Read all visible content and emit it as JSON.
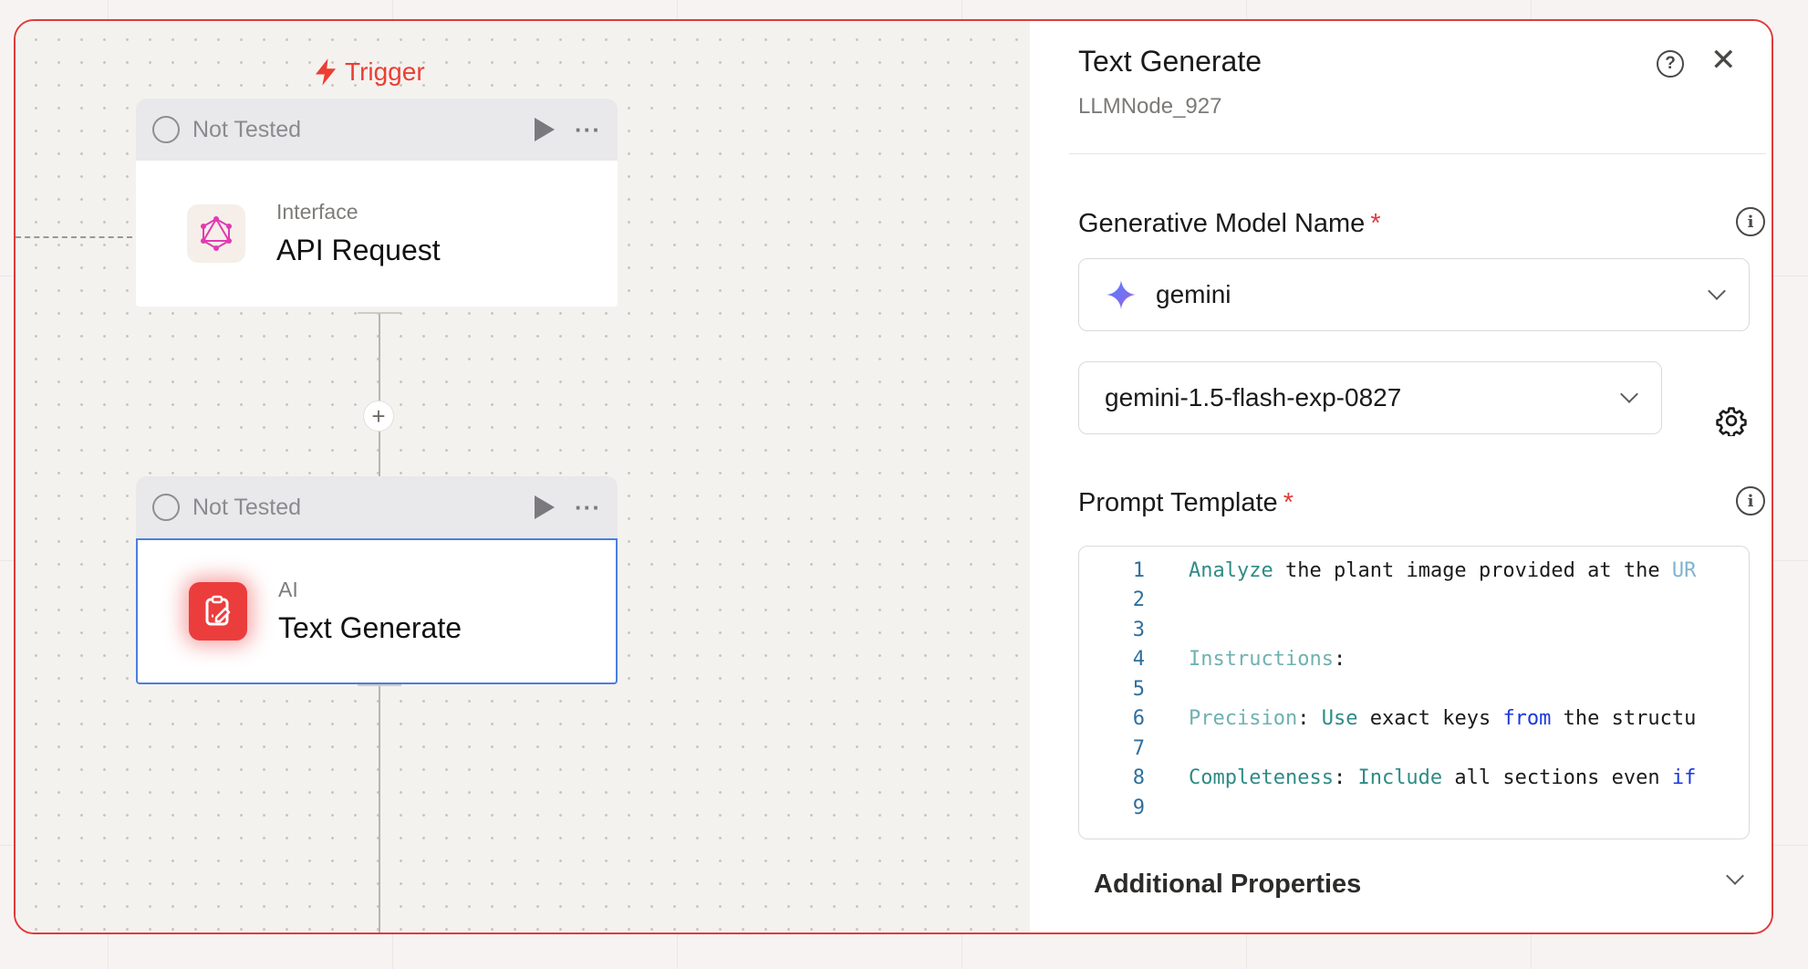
{
  "canvas": {
    "trigger_label": "Trigger",
    "nodes": [
      {
        "status": "Not Tested",
        "kind": "Interface",
        "name": "API Request",
        "icon": "graphql-icon",
        "selected": false
      },
      {
        "status": "Not Tested",
        "kind": "AI",
        "name": "Text Generate",
        "icon": "clipboard-edit-icon",
        "selected": true
      }
    ],
    "add_step_symbol": "+"
  },
  "panel": {
    "title": "Text Generate",
    "subtitle": "LLMNode_927",
    "help_symbol": "?",
    "close_symbol": "✕",
    "model_label": "Generative Model Name",
    "required_mark": "*",
    "info_symbol": "i",
    "provider": {
      "value": "gemini",
      "icon": "gemini-sparkle-icon"
    },
    "model": {
      "value": "gemini-1.5-flash-exp-0827"
    },
    "prompt_label": "Prompt Template",
    "code_lines": [
      {
        "num": "1",
        "text": "Analyze the plant image provided at the UR"
      },
      {
        "num": "2",
        "text": ""
      },
      {
        "num": "3",
        "text": ""
      },
      {
        "num": "4",
        "text": "Instructions:"
      },
      {
        "num": "5",
        "text": ""
      },
      {
        "num": "6",
        "text": "Precision: Use exact keys from the structu"
      },
      {
        "num": "7",
        "text": ""
      },
      {
        "num": "8",
        "text": "Completeness: Include all sections even if"
      },
      {
        "num": "9",
        "text": ""
      }
    ],
    "additional_properties_label": "Additional Properties"
  },
  "colors": {
    "accent_red": "#e03a3a",
    "selected_blue": "#4a7fe0",
    "trigger_red": "#ec3e33"
  }
}
